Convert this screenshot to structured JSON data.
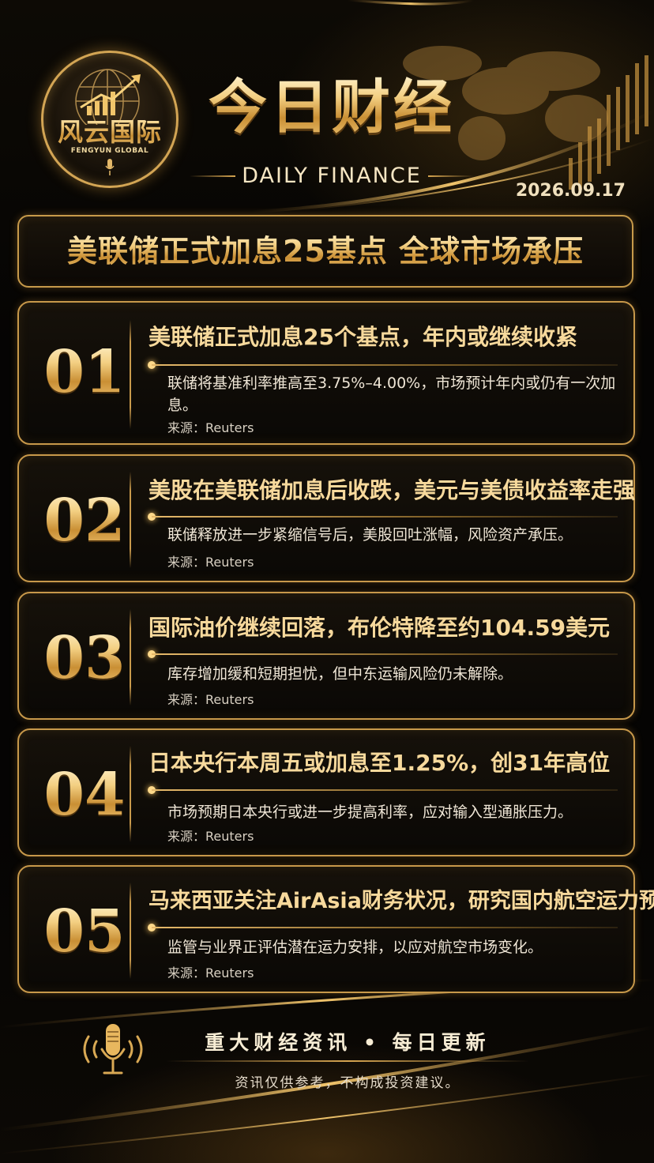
{
  "brand": {
    "name_cn": "风云国际",
    "name_en": "FENGYUN GLOBAL"
  },
  "header": {
    "title": "今日财经",
    "subtitle": "DAILY FINANCE",
    "date": "2026.09.17"
  },
  "headline": "美联储正式加息25基点 全球市场承压",
  "news": [
    {
      "number": "01",
      "title": "美联储正式加息25个基点，年内或继续收紧",
      "description": "联储将基准利率推高至3.75%–4.00%，市场预计年内或仍有一次加息。",
      "source": "来源：Reuters"
    },
    {
      "number": "02",
      "title": "美股在美联储加息后收跌，美元与美债收益率走强",
      "description": "联储释放进一步紧缩信号后，美股回吐涨幅，风险资产承压。",
      "source": "来源：Reuters"
    },
    {
      "number": "03",
      "title": "国际油价继续回落，布伦特降至约104.59美元",
      "description": "库存增加缓和短期担忧，但中东运输风险仍未解除。",
      "source": "来源：Reuters"
    },
    {
      "number": "04",
      "title": "日本央行本周五或加息至1.25%，创31年高位",
      "description": "市场预期日本央行或进一步提高利率，应对输入型通胀压力。",
      "source": "来源：Reuters"
    },
    {
      "number": "05",
      "title": "马来西亚关注AirAsia财务状况，研究国内航空运力预案",
      "description": "监管与业界正评估潜在运力安排，以应对航空市场变化。",
      "source": "来源：Reuters"
    }
  ],
  "footer": {
    "slogan": "重大财经资讯 • 每日更新",
    "disclaimer": "资讯仅供参考，不构成投资建议。"
  },
  "colors": {
    "gold": "#d6a550",
    "background": "#050403"
  },
  "icons": [
    "globe-icon",
    "trend-arrow-icon",
    "microphone-icon"
  ]
}
